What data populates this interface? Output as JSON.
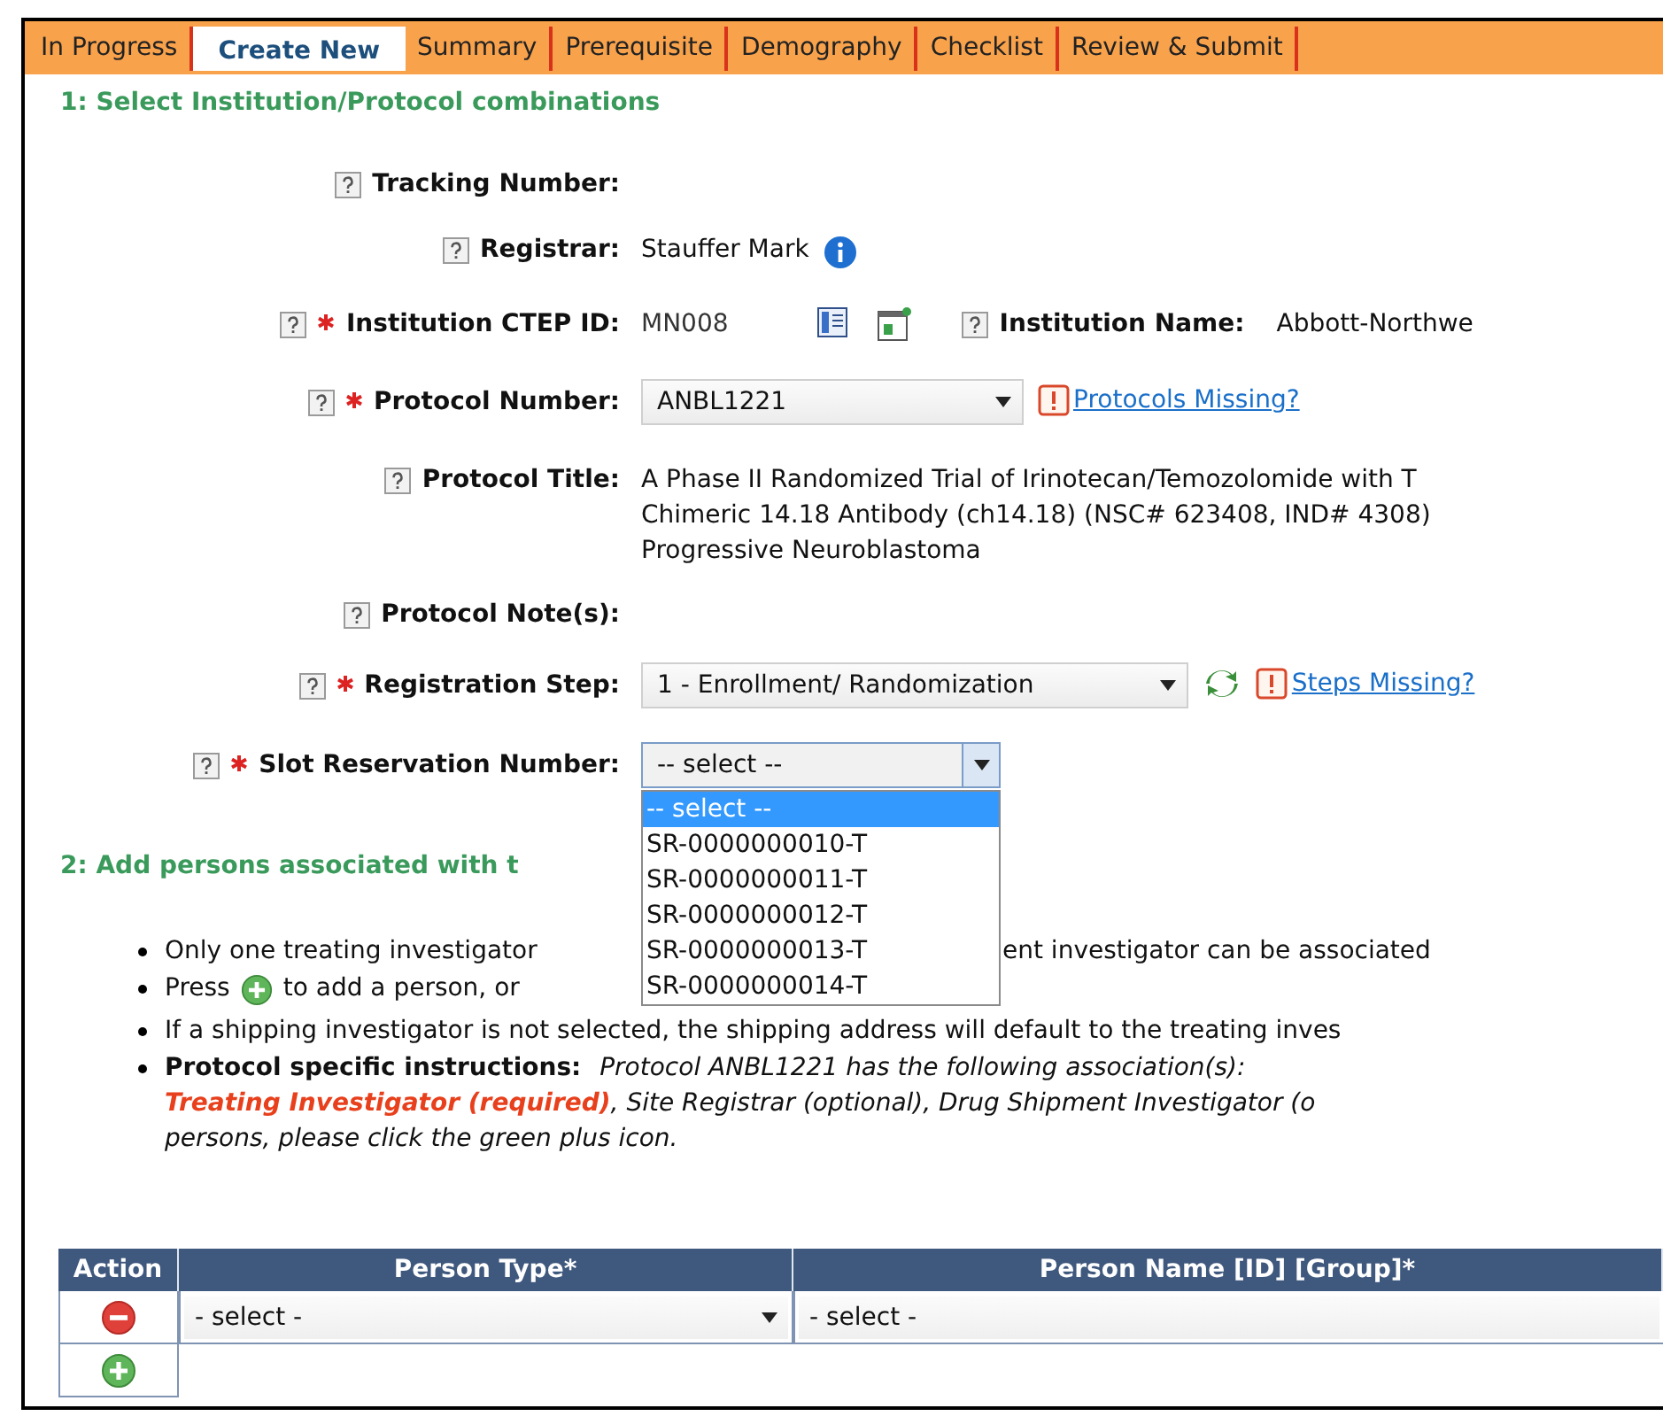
{
  "tabs": [
    {
      "label": "In Progress",
      "selected": false
    },
    {
      "label": "Create New",
      "selected": true
    },
    {
      "label": "Summary",
      "selected": false
    },
    {
      "label": "Prerequisite",
      "selected": false
    },
    {
      "label": "Demography",
      "selected": false
    },
    {
      "label": "Checklist",
      "selected": false
    },
    {
      "label": "Review & Submit",
      "selected": false
    }
  ],
  "section_1": {
    "title": "1: Select Institution/Protocol combinations",
    "fields": [
      {
        "kind": "text",
        "label": "Tracking Number:",
        "required": false
      },
      {
        "kind": "text",
        "label": "Registrar:",
        "required": false,
        "value": "Stauffer Mark",
        "info_icon": true
      },
      {
        "kind": "institution",
        "label": "Institution CTEP ID:",
        "required": true,
        "value": "MN008",
        "name_label": "Institution Name:",
        "name_value": "Abbott-Northwe"
      },
      {
        "kind": "select",
        "label": "Protocol Number:",
        "required": true,
        "value": "ANBL1221",
        "link": "Protocols Missing?"
      },
      {
        "kind": "multiline",
        "label": "Protocol Title:",
        "required": false,
        "lines": [
          "A Phase II Randomized Trial of Irinotecan/Temozolomide with T",
          "Chimeric 14.18 Antibody (ch14.18) (NSC# 623408, IND# 4308)",
          "Progressive Neuroblastoma"
        ]
      },
      {
        "kind": "text",
        "label": "Protocol Note(s):",
        "required": false
      },
      {
        "kind": "select",
        "label": "Registration Step:",
        "required": true,
        "value": "1 - Enrollment/ Randomization",
        "refresh_icon": true,
        "link": "Steps Missing?"
      },
      {
        "kind": "dropdown",
        "label": "Slot Reservation Number:",
        "required": true,
        "value": "-- select --",
        "open": true,
        "options": [
          {
            "label": "-- select --",
            "selected": true
          },
          {
            "label": "SR-0000000010-T",
            "selected": false
          },
          {
            "label": "SR-0000000011-T",
            "selected": false
          },
          {
            "label": "SR-0000000012-T",
            "selected": false
          },
          {
            "label": "SR-0000000013-T",
            "selected": false
          },
          {
            "label": "SR-0000000014-T",
            "selected": false
          }
        ]
      }
    ]
  },
  "section_2": {
    "title": "2: Add persons associated with t",
    "bullets": [
      {
        "kind": "covered",
        "before": "Only one treating investigator",
        "after": "ent investigator can be associated"
      },
      {
        "kind": "press",
        "before": "Press",
        "after": "to add a person, or"
      },
      {
        "kind": "plain",
        "text": "If a shipping investigator is not selected, the shipping address will default to the treating inves"
      },
      {
        "kind": "instructions",
        "label": "Protocol specific instructions:",
        "intro": "Protocol ANBL1221 has the following association(s):",
        "required": "Treating Investigator (required)",
        "rest": ", Site Registrar (optional), Drug Shipment Investigator (o",
        "last": "persons, please click the green plus icon."
      }
    ]
  },
  "table": {
    "columns": [
      "Action",
      "Person Type*",
      "Person Name [ID] [Group]*"
    ],
    "rows": [
      {
        "kind": "remove",
        "person_type": "- select -",
        "person_name": "- select -"
      },
      {
        "kind": "add"
      }
    ]
  }
}
